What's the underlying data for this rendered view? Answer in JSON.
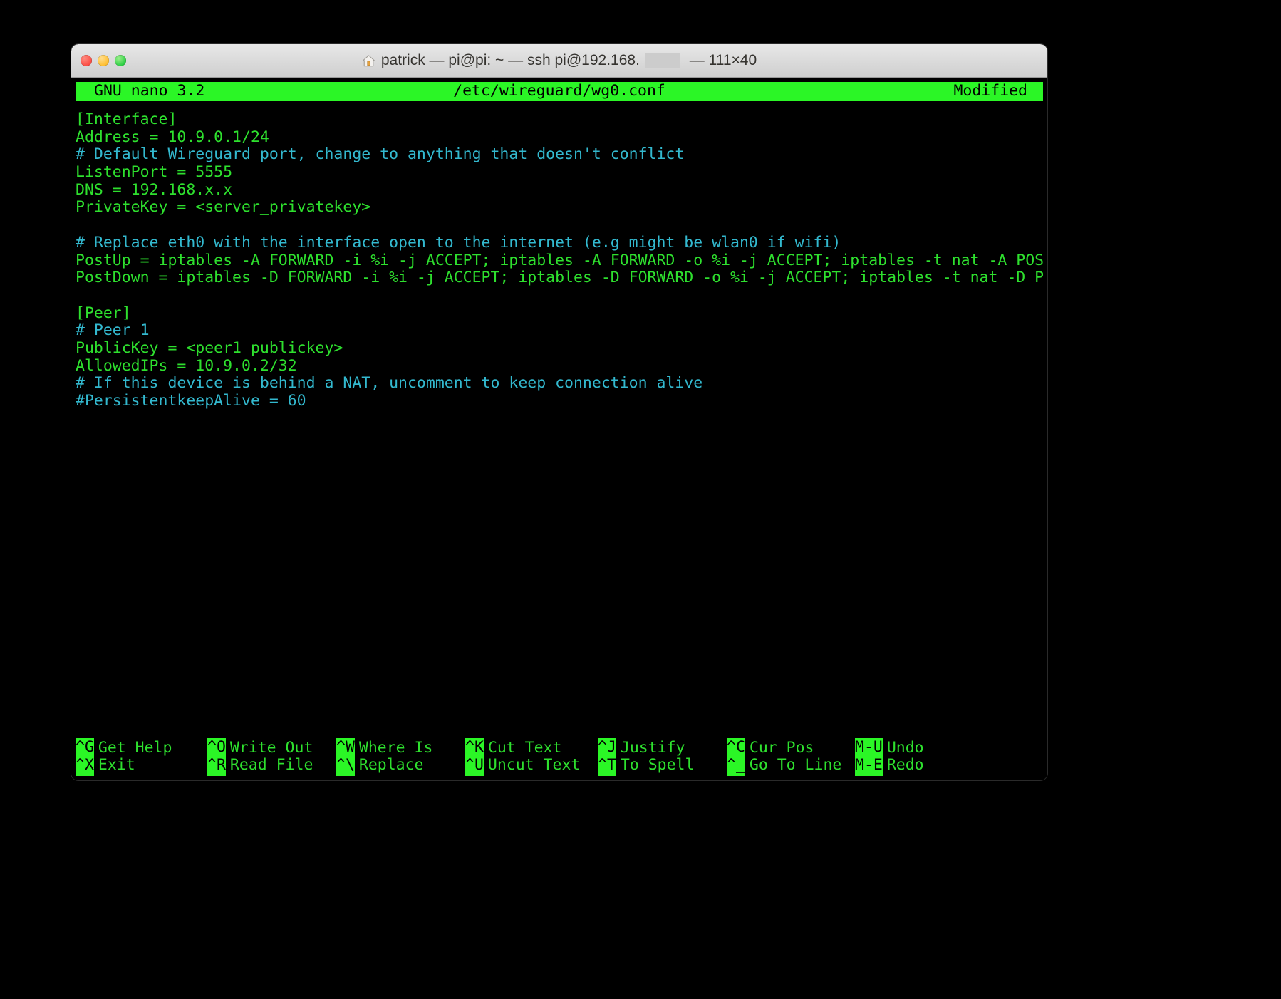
{
  "window": {
    "traffic_lights": [
      "close",
      "minimize",
      "maximize"
    ],
    "title": {
      "icon": "home-icon",
      "before_redaction": "patrick — pi@pi: ~ — ssh pi@192.168.",
      "after_redaction": " — 111×40",
      "full": "patrick — pi@pi: ~ — ssh pi@192.168.▮ — 111×40"
    }
  },
  "nano": {
    "version": "GNU nano 3.2",
    "filename": "/etc/wireguard/wg0.conf",
    "state": "Modified",
    "colors": {
      "header_bg": "#2bf626",
      "header_fg": "#000000",
      "config_text": "#2ee02e",
      "comment_text": "#33b9cf",
      "background": "#000000"
    },
    "lines": [
      {
        "text": "[Interface]",
        "type": "config"
      },
      {
        "text": "Address = 10.9.0.1/24",
        "type": "config"
      },
      {
        "text": "# Default Wireguard port, change to anything that doesn't conflict",
        "type": "comment"
      },
      {
        "text": "ListenPort = 5555",
        "type": "config"
      },
      {
        "text": "DNS = 192.168.x.x",
        "type": "config"
      },
      {
        "text": "PrivateKey = <server_privatekey>",
        "type": "config"
      },
      {
        "text": "",
        "type": "blank"
      },
      {
        "text": "# Replace eth0 with the interface open to the internet (e.g might be wlan0 if wifi)",
        "type": "comment"
      },
      {
        "text": "PostUp = iptables -A FORWARD -i %i -j ACCEPT; iptables -A FORWARD -o %i -j ACCEPT; iptables -t nat -A POSTROUT$",
        "type": "config"
      },
      {
        "text": "PostDown = iptables -D FORWARD -i %i -j ACCEPT; iptables -D FORWARD -o %i -j ACCEPT; iptables -t nat -D POSTRO$",
        "type": "config"
      },
      {
        "text": "",
        "type": "blank"
      },
      {
        "text": "[Peer]",
        "type": "config"
      },
      {
        "text": "# Peer 1",
        "type": "comment"
      },
      {
        "text": "PublicKey = <peer1_publickey>",
        "type": "config"
      },
      {
        "text": "AllowedIPs = 10.9.0.2/32",
        "type": "config"
      },
      {
        "text": "# If this device is behind a NAT, uncomment to keep connection alive",
        "type": "comment"
      },
      {
        "text": "#PersistentkeepAlive = 60",
        "type": "comment"
      }
    ],
    "shortcuts": {
      "row1": [
        {
          "key": "^G",
          "label": "Get Help"
        },
        {
          "key": "^O",
          "label": "Write Out"
        },
        {
          "key": "^W",
          "label": "Where Is"
        },
        {
          "key": "^K",
          "label": "Cut Text"
        },
        {
          "key": "^J",
          "label": "Justify"
        },
        {
          "key": "^C",
          "label": "Cur Pos"
        },
        {
          "key": "M-U",
          "label": "Undo"
        }
      ],
      "row2": [
        {
          "key": "^X",
          "label": "Exit"
        },
        {
          "key": "^R",
          "label": "Read File"
        },
        {
          "key": "^\\",
          "label": "Replace"
        },
        {
          "key": "^U",
          "label": "Uncut Text"
        },
        {
          "key": "^T",
          "label": "To Spell"
        },
        {
          "key": "^_",
          "label": "Go To Line"
        },
        {
          "key": "M-E",
          "label": "Redo"
        }
      ]
    }
  }
}
